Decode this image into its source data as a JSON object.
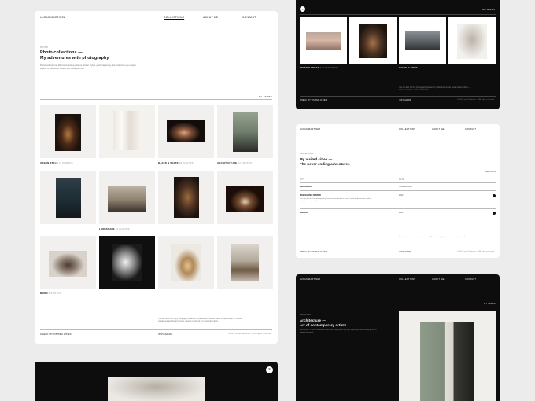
{
  "brand": "LUCAS MARTINEZ",
  "nav": {
    "collections": "COLLECTIONS",
    "about": "ABOUT ME",
    "contact": "CONTACT"
  },
  "collections_page": {
    "eyebrow": "WORK",
    "title_line1": "Photo collections —",
    "title_line2": "My adventures with photography",
    "intro": "Photo collections: albums featuring various artistic styles, each capturing and exploring one unique aspect of the world. Follow the visual journey.",
    "all_series": "ALL SERIES",
    "captions": [
      {
        "name": "URBAN STYLE",
        "meta": "12 PHOTOS"
      },
      {
        "name": "BLACK & WHITE",
        "meta": "18 PHOTOS"
      },
      {
        "name": "ARCHITECTURE",
        "meta": "24 PHOTOS"
      },
      {
        "name": "LANDSCAPE",
        "meta": "21 PHOTOS"
      },
      {
        "name": "MOOD",
        "meta": "8 PHOTOS"
      }
    ],
    "footer_note": "You can also find my photography featured in publications across social media profiles — Online magazines and travel journals, please reach out for more information.",
    "footer_left": "CHECK MY VISITED CITIES",
    "footer_mid": "INSTAGRAM",
    "footer_right": "©2024 Lucas Martinez — All rights reserved"
  },
  "dark_gallery": {
    "all_series": "ALL SERIES",
    "captions": [
      {
        "name": "WESTERN BRIDGE",
        "meta": "SAN FRANCISCO"
      },
      {
        "name": "CHAPEL & STONE",
        "meta": ""
      }
    ],
    "note": "You can also find my photography featured in publications across social media profiles — Online magazines and travel journals.",
    "footer_left": "CHECK MY VISITED CITIES",
    "footer_mid": "INSTAGRAM",
    "footer_right": "©2024 Lucas Martinez — All rights reserved"
  },
  "cities_page": {
    "eyebrow": "TRAVEL DIARY",
    "title_line1": "My visited cities —",
    "title_line2": "The never ending adventures",
    "all_label": "ALL LISTS",
    "col_city": "CITY",
    "col_date": "DATE",
    "rows": [
      {
        "city": "AMSTERDAM",
        "sub": "",
        "date": "SUMMER 2023"
      },
      {
        "city": "BARCELONA CENTER",
        "sub": "You can also find my photography featured in publications across social media profiles, online magazines and travel journals.",
        "date": "2022"
      },
      {
        "city": "LONDON",
        "sub": "",
        "date": "2021"
      }
    ],
    "footer_note": "Want to find more about my adventures? Check out my blog posts and more photo collections.",
    "footer_left": "CHECK MY VISITED CITIES",
    "footer_mid": "INSTAGRAM",
    "footer_right": "©2024 Lucas Martinez — All rights reserved"
  },
  "architecture_page": {
    "eyebrow": "PROJECTS",
    "title_line1": "Architecture —",
    "title_line2": "Art of contemporary artists",
    "intro": "Architecture: a series focused on structures, composition and light, exploring modern buildings with a minimal approach.",
    "all_label": "ALL SERIES"
  },
  "close_glyph": "×"
}
